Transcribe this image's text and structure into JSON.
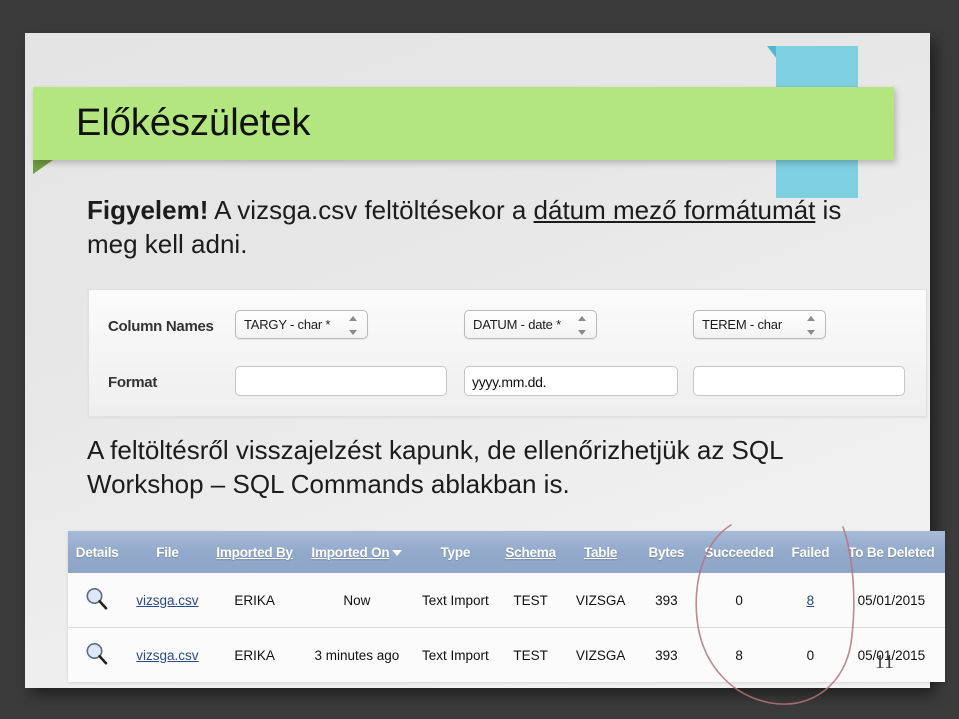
{
  "slide": {
    "title": "Előkészületek",
    "page_number": "11",
    "theme": {
      "banner_green": "#b4e67f",
      "accent_blue": "#7ecfe0",
      "background_gray": "#3b3b3b",
      "slide_surface": "#ececec",
      "table_header_blue": "#93a9cb",
      "link_blue": "#2b4a8b",
      "annotation_red": "#b5737d"
    }
  },
  "warning_paragraph": {
    "lead": "Figyelem!",
    "text_before": " A vizsga.csv feltöltésekor a ",
    "underlined": "dátum mező formátumát",
    "text_after": " is meg kell adni."
  },
  "feedback_paragraph": {
    "text": "A feltöltésről visszajelzést kapunk, de ellenőrizhetjük az SQL Workshop – SQL Commands ablakban is."
  },
  "form_panel": {
    "row_labels": {
      "column_names": "Column Names",
      "format": "Format"
    },
    "columns": [
      {
        "select_value": "TARGY - char *",
        "format_value": "",
        "format_placeholder": ""
      },
      {
        "select_value": "DATUM - date *",
        "format_value": "yyyy.mm.dd.",
        "format_placeholder": ""
      },
      {
        "select_value": "TEREM - char",
        "format_value": "",
        "format_placeholder": ""
      }
    ]
  },
  "results_table": {
    "headers": [
      {
        "label": "Details",
        "underlined": false,
        "sorted": false
      },
      {
        "label": "File",
        "underlined": false,
        "sorted": false
      },
      {
        "label": "Imported By",
        "underlined": true,
        "sorted": false
      },
      {
        "label": "Imported On",
        "underlined": true,
        "sorted": true
      },
      {
        "label": "Type",
        "underlined": false,
        "sorted": false
      },
      {
        "label": "Schema",
        "underlined": true,
        "sorted": false
      },
      {
        "label": "Table",
        "underlined": true,
        "sorted": false
      },
      {
        "label": "Bytes",
        "underlined": false,
        "sorted": false
      },
      {
        "label": "Succeeded",
        "underlined": false,
        "sorted": false
      },
      {
        "label": "Failed",
        "underlined": false,
        "sorted": false
      },
      {
        "label": "To Be Deleted",
        "underlined": false,
        "sorted": false
      }
    ],
    "rows": [
      {
        "details_icon": "magnifier-icon",
        "file": "vizsga.csv",
        "imported_by": "ERIKA",
        "imported_on": "Now",
        "type": "Text Import",
        "schema": "TEST",
        "table": "VIZSGA",
        "bytes": "393",
        "succeeded": "0",
        "succeeded_is_link": false,
        "failed": "8",
        "failed_is_link": true,
        "to_be_deleted": "05/01/2015"
      },
      {
        "details_icon": "magnifier-icon",
        "file": "vizsga.csv",
        "imported_by": "ERIKA",
        "imported_on": "3 minutes ago",
        "type": "Text Import",
        "schema": "TEST",
        "table": "VIZSGA",
        "bytes": "393",
        "succeeded": "8",
        "succeeded_is_link": false,
        "failed": "0",
        "failed_is_link": false,
        "to_be_deleted": "05/01/2015"
      }
    ]
  }
}
